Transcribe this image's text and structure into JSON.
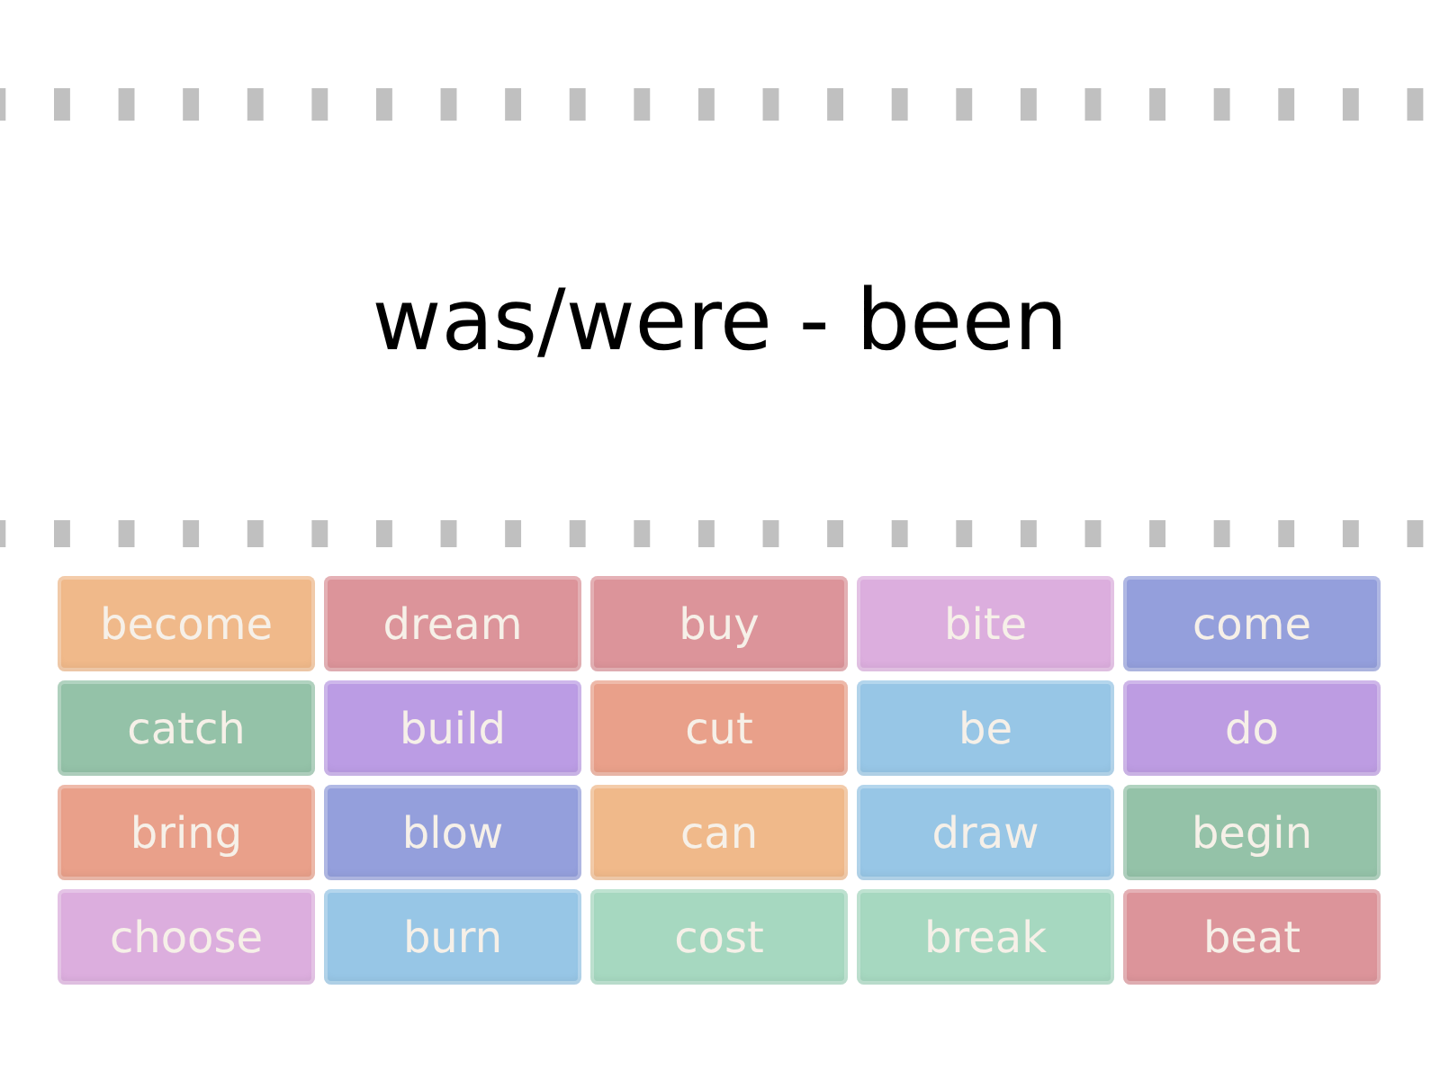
{
  "title": "was/were - been",
  "tiles": [
    {
      "label": "become",
      "color": "#f0b98a"
    },
    {
      "label": "dream",
      "color": "#dc949a"
    },
    {
      "label": "buy",
      "color": "#dc949a"
    },
    {
      "label": "bite",
      "color": "#dcaede"
    },
    {
      "label": "come",
      "color": "#949fdc"
    },
    {
      "label": "catch",
      "color": "#94c2a8"
    },
    {
      "label": "build",
      "color": "#bb9ce4"
    },
    {
      "label": "cut",
      "color": "#e9a08a"
    },
    {
      "label": "be",
      "color": "#97c6e6"
    },
    {
      "label": "do",
      "color": "#bd9ce2"
    },
    {
      "label": "bring",
      "color": "#e9a08a"
    },
    {
      "label": "blow",
      "color": "#949fdc"
    },
    {
      "label": "can",
      "color": "#f0b98a"
    },
    {
      "label": "draw",
      "color": "#97c6e6"
    },
    {
      "label": "begin",
      "color": "#94c2a8"
    },
    {
      "label": "choose",
      "color": "#dcaede"
    },
    {
      "label": "burn",
      "color": "#97c6e6"
    },
    {
      "label": "cost",
      "color": "#a6d8c0"
    },
    {
      "label": "break",
      "color": "#a6d8c0"
    },
    {
      "label": "beat",
      "color": "#dc949a"
    }
  ]
}
